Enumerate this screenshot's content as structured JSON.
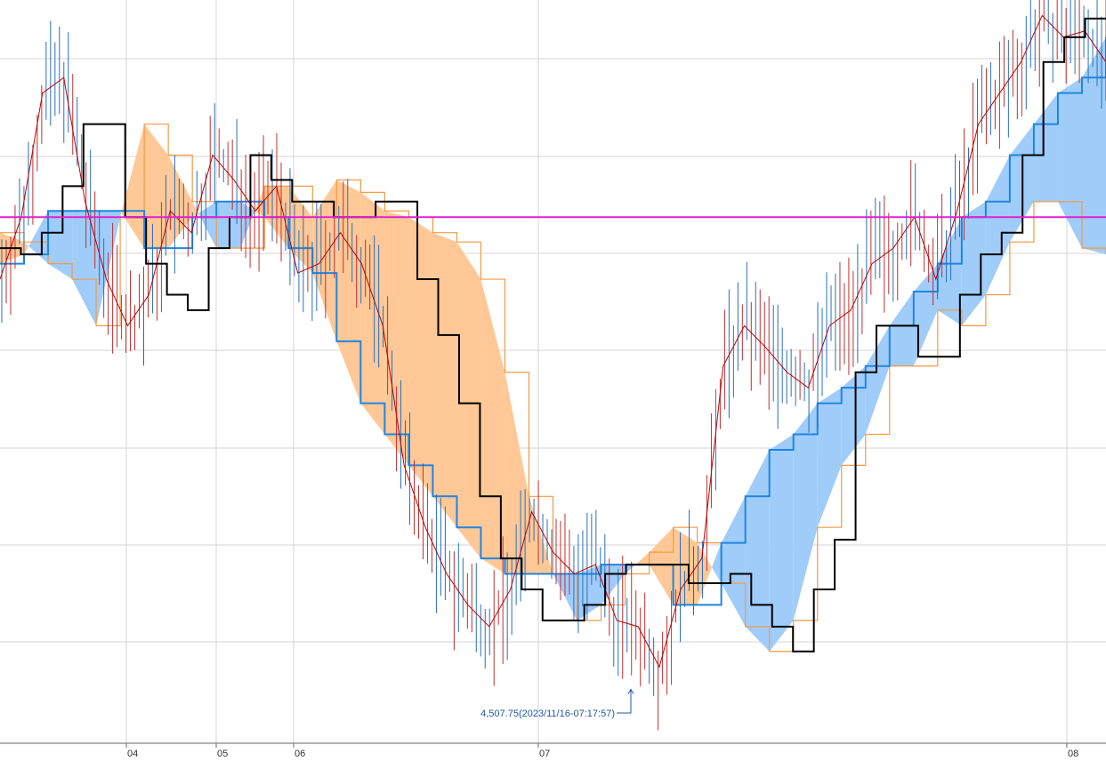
{
  "chart_data": {
    "type": "candlestick_ichimoku",
    "x_ticks": [
      "04",
      "05",
      "06",
      "07",
      "08"
    ],
    "annotation": {
      "text": "4,507.75(2023/11/16-07:17:57)",
      "value": 4507.75
    },
    "horizontal_line": {
      "level": 4660,
      "color": "#e020d0"
    },
    "y_range": [
      4495,
      4730
    ],
    "grid": true,
    "colors": {
      "bull_kumo": "#ffc896",
      "bull_kumo_edge": "#f39a45",
      "bear_kumo": "#a0ccfa",
      "bear_kumo_edge": "#1f86e0",
      "tenkan": "#c00000",
      "kijun": "#000000",
      "candle_up": "#c03030",
      "candle_down": "#2a6fb8"
    },
    "series": [
      {
        "key": "kijun",
        "values": [
          4650,
          4648,
          4655,
          4670,
          4690,
          4690,
          4660,
          4645,
          4635,
          4630,
          4650,
          4660,
          4680,
          4672,
          4665,
          4665,
          4660,
          4660,
          4665,
          4665,
          4640,
          4622,
          4600,
          4570,
          4550,
          4540,
          4530,
          4530,
          4535,
          4545,
          4548,
          4548,
          4548,
          4542,
          4542,
          4545,
          4535,
          4528,
          4520,
          4540,
          4556,
          4610,
          4625,
          4625,
          4615,
          4615,
          4635,
          4648,
          4655,
          4680,
          4710,
          4718,
          4724,
          4724
        ]
      },
      {
        "key": "tenkan",
        "values": [
          4640,
          4660,
          4700,
          4705,
          4665,
          4640,
          4625,
          4635,
          4662,
          4655,
          4680,
          4672,
          4662,
          4670,
          4642,
          4645,
          4655,
          4645,
          4625,
          4580,
          4560,
          4545,
          4535,
          4528,
          4540,
          4565,
          4552,
          4545,
          4548,
          4530,
          4528,
          4515,
          4540,
          4550,
          4612,
          4625,
          4618,
          4610,
          4605,
          4625,
          4630,
          4645,
          4650,
          4660,
          4640,
          4662,
          4690,
          4700,
          4710,
          4725,
          4718,
          4720,
          4710
        ]
      },
      {
        "key": "senkou_a",
        "values": [
          4655,
          4652,
          4645,
          4640,
          4625,
          4660,
          4690,
          4680,
          4665,
          4650,
          4650,
          4670,
          4670,
          4660,
          4672,
          4668,
          4662,
          4660,
          4655,
          4652,
          4640,
          4610,
          4570,
          4545,
          4530,
          4535,
          4545,
          4552,
          4560,
          4555,
          4542,
          4528,
          4520,
          4530,
          4560,
          4580,
          4590,
          4612,
          4612,
          4630,
          4625,
          4635,
          4652,
          4665,
          4665,
          4650,
          4648,
          4665,
          4695,
          4710,
          4715,
          4720
        ]
      },
      {
        "key": "senkou_b",
        "values": [
          4645,
          4648,
          4662,
          4662,
          4662,
          4662,
          4650,
          4650,
          4660,
          4665,
          4665,
          4660,
          4650,
          4642,
          4620,
          4600,
          4590,
          4580,
          4570,
          4560,
          4550,
          4545,
          4545,
          4545,
          4545,
          4548,
          4548,
          4548,
          4535,
          4535,
          4555,
          4570,
          4585,
          4590,
          4600,
          4605,
          4612,
          4625,
          4636,
          4645,
          4660,
          4665,
          4680,
          4690,
          4700,
          4705,
          4718
        ]
      }
    ]
  }
}
